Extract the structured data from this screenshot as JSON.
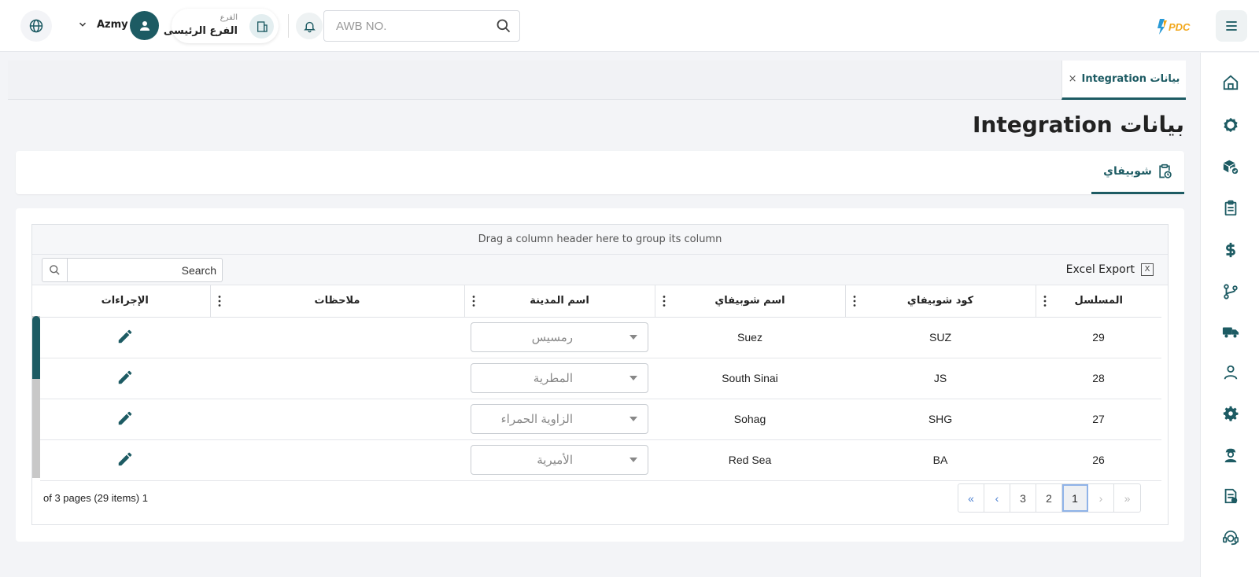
{
  "header": {
    "user_name": "Azmy",
    "branch_label": "الفرع",
    "branch_name": "الفرع الرئيسى",
    "awb_placeholder": "AWB NO.",
    "logo_text": "PDC"
  },
  "tabs": [
    {
      "label": "بيانات Integration",
      "close": "×"
    }
  ],
  "page_title": "بيانات Integration",
  "subtab": {
    "label": "شوبيفاي"
  },
  "grid": {
    "group_hint": "Drag a column header here to group its column",
    "search_placeholder": "Search",
    "excel_label": "Excel Export",
    "excel_icon_glyph": "X",
    "columns": [
      "المسلسل",
      "كود شوبيفاي",
      "اسم شوبيفاي",
      "اسم المدينة",
      "ملاحظات",
      "الإجراءات"
    ],
    "rows": [
      {
        "serial": "29",
        "code": "SUZ",
        "name": "Suez",
        "city": "رمسيس",
        "notes": ""
      },
      {
        "serial": "28",
        "code": "JS",
        "name": "South Sinai",
        "city": "المطرية",
        "notes": ""
      },
      {
        "serial": "27",
        "code": "SHG",
        "name": "Sohag",
        "city": "الزاوية الحمراء",
        "notes": ""
      },
      {
        "serial": "26",
        "code": "BA",
        "name": "Red Sea",
        "city": "الأميرية",
        "notes": ""
      }
    ],
    "pager_info": "of 3 pages (29 items) 1",
    "pages": [
      "«",
      "‹",
      "3",
      "2",
      "1",
      "›",
      "»"
    ],
    "current_page": "1"
  },
  "colors": {
    "primary": "#1d5b63",
    "pager_nav": "#4a7fd1"
  },
  "sidebar_icons": [
    "home-icon",
    "new-badge-icon",
    "packages-icon",
    "clipboard-icon",
    "dollar-icon",
    "branch-icon",
    "truck-icon",
    "person-icon",
    "gear-icon",
    "courier-icon",
    "invoice-icon",
    "ai-support-icon"
  ]
}
